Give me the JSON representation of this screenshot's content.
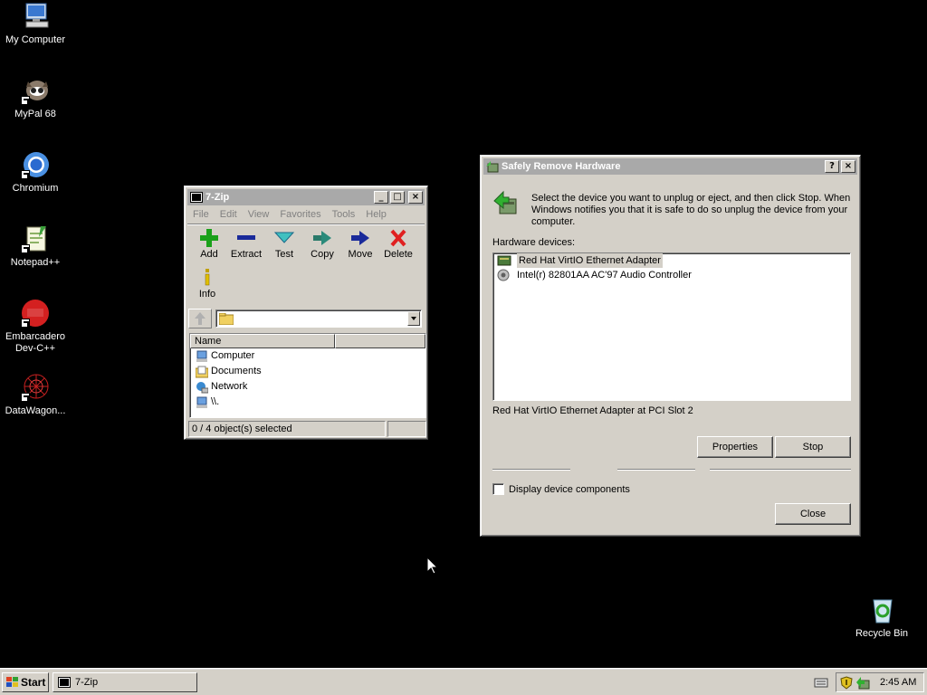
{
  "desktop": {
    "icons": [
      {
        "label": "My Computer"
      },
      {
        "label": "MyPal 68"
      },
      {
        "label": "Chromium"
      },
      {
        "label": "Notepad++"
      },
      {
        "label": "Embarcadero Dev-C++"
      },
      {
        "label": "DataWagon..."
      },
      {
        "label": "Recycle Bin"
      }
    ]
  },
  "sevenzip": {
    "title": "7-Zip",
    "menu": [
      "File",
      "Edit",
      "View",
      "Favorites",
      "Tools",
      "Help"
    ],
    "toolbar": [
      "Add",
      "Extract",
      "Test",
      "Copy",
      "Move",
      "Delete",
      "Info"
    ],
    "address": "",
    "columns": [
      "Name",
      ""
    ],
    "rows": [
      "Computer",
      "Documents",
      "Network",
      "\\\\."
    ],
    "status": "0 / 4 object(s) selected"
  },
  "safely_remove": {
    "title": "Safely Remove Hardware",
    "instructions": "Select the device you want to unplug or eject, and then click Stop. When Windows notifies you that it is safe to do so unplug the device from your computer.",
    "hardware_label": "Hardware devices:",
    "devices": [
      "Red Hat VirtIO Ethernet Adapter",
      "Intel(r) 82801AA AC'97 Audio Controller"
    ],
    "selected_description": "Red Hat VirtIO Ethernet Adapter at PCI Slot 2",
    "properties_label": "Properties",
    "stop_label": "Stop",
    "display_components_label": "Display device components",
    "display_components_checked": false,
    "close_label": "Close"
  },
  "taskbar": {
    "start_label": "Start",
    "tasks": [
      "7-Zip"
    ],
    "clock": "2:45 AM"
  },
  "colors": {
    "desktop": "#000000",
    "inactive_title": "#a9a9a9",
    "face": "#d4d0c8",
    "delete_red": "#e02020",
    "add_green": "#1aa01a",
    "blue": "#1a2a9a"
  }
}
